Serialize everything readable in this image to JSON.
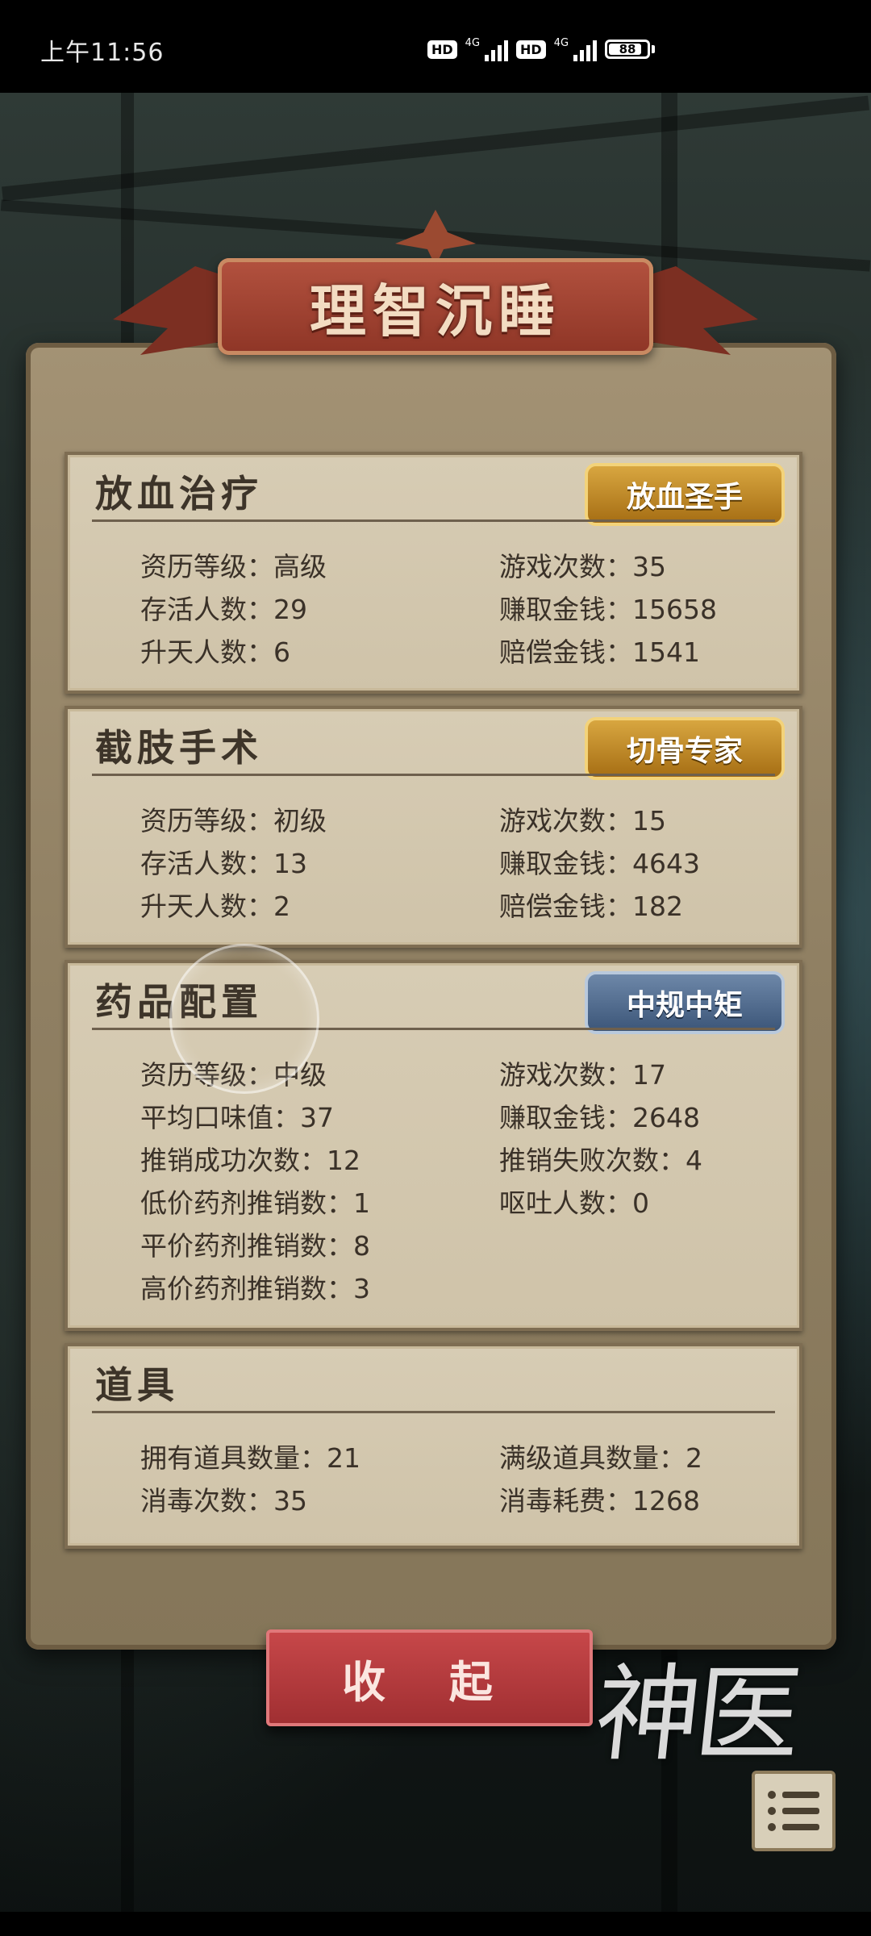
{
  "status_bar": {
    "time": "上午11:56",
    "hd1": "HD",
    "net1": "4G",
    "hd2": "HD",
    "net2": "4G",
    "battery": "88"
  },
  "title": "理智沉睡",
  "panels": {
    "bloodletting": {
      "title": "放血治疗",
      "badge": "放血圣手",
      "stats": {
        "level": "资历等级：高级",
        "games": "游戏次数：35",
        "survivors": "存活人数：29",
        "money_earned": "赚取金钱：15658",
        "ascended": "升天人数：6",
        "compensation": "赔偿金钱：1541"
      }
    },
    "amputation": {
      "title": "截肢手术",
      "badge": "切骨专家",
      "stats": {
        "level": "资历等级：初级",
        "games": "游戏次数：15",
        "survivors": "存活人数：13",
        "money_earned": "赚取金钱：4643",
        "ascended": "升天人数：2",
        "compensation": "赔偿金钱：182"
      }
    },
    "pharmacy": {
      "title": "药品配置",
      "badge": "中规中矩",
      "stats": {
        "level": "资历等级：中级",
        "games": "游戏次数：17",
        "avg_taste": "平均口味值：37",
        "money_earned": "赚取金钱：2648",
        "sell_success": "推销成功次数：12",
        "sell_fail": "推销失败次数：4",
        "low_price": "低价药剂推销数：1",
        "vomit": "呕吐人数：0",
        "mid_price": "平价药剂推销数：8",
        "high_price": "高价药剂推销数：3"
      }
    },
    "items": {
      "title": "道具",
      "stats": {
        "owned": "拥有道具数量：21",
        "max_level": "满级道具数量：2",
        "disinfect_count": "消毒次数：35",
        "disinfect_cost": "消毒耗费：1268"
      }
    }
  },
  "collapse_button": "收 起",
  "logo_text": "神医",
  "colors": {
    "parchment": "#d7ccb4",
    "banner_red": "#a9452f",
    "gold_badge": "#c08a2a",
    "blue_badge": "#52698c",
    "button_red": "#b63b3e"
  },
  "icons": [
    "menu-list-icon",
    "battery-icon",
    "signal-icon"
  ]
}
